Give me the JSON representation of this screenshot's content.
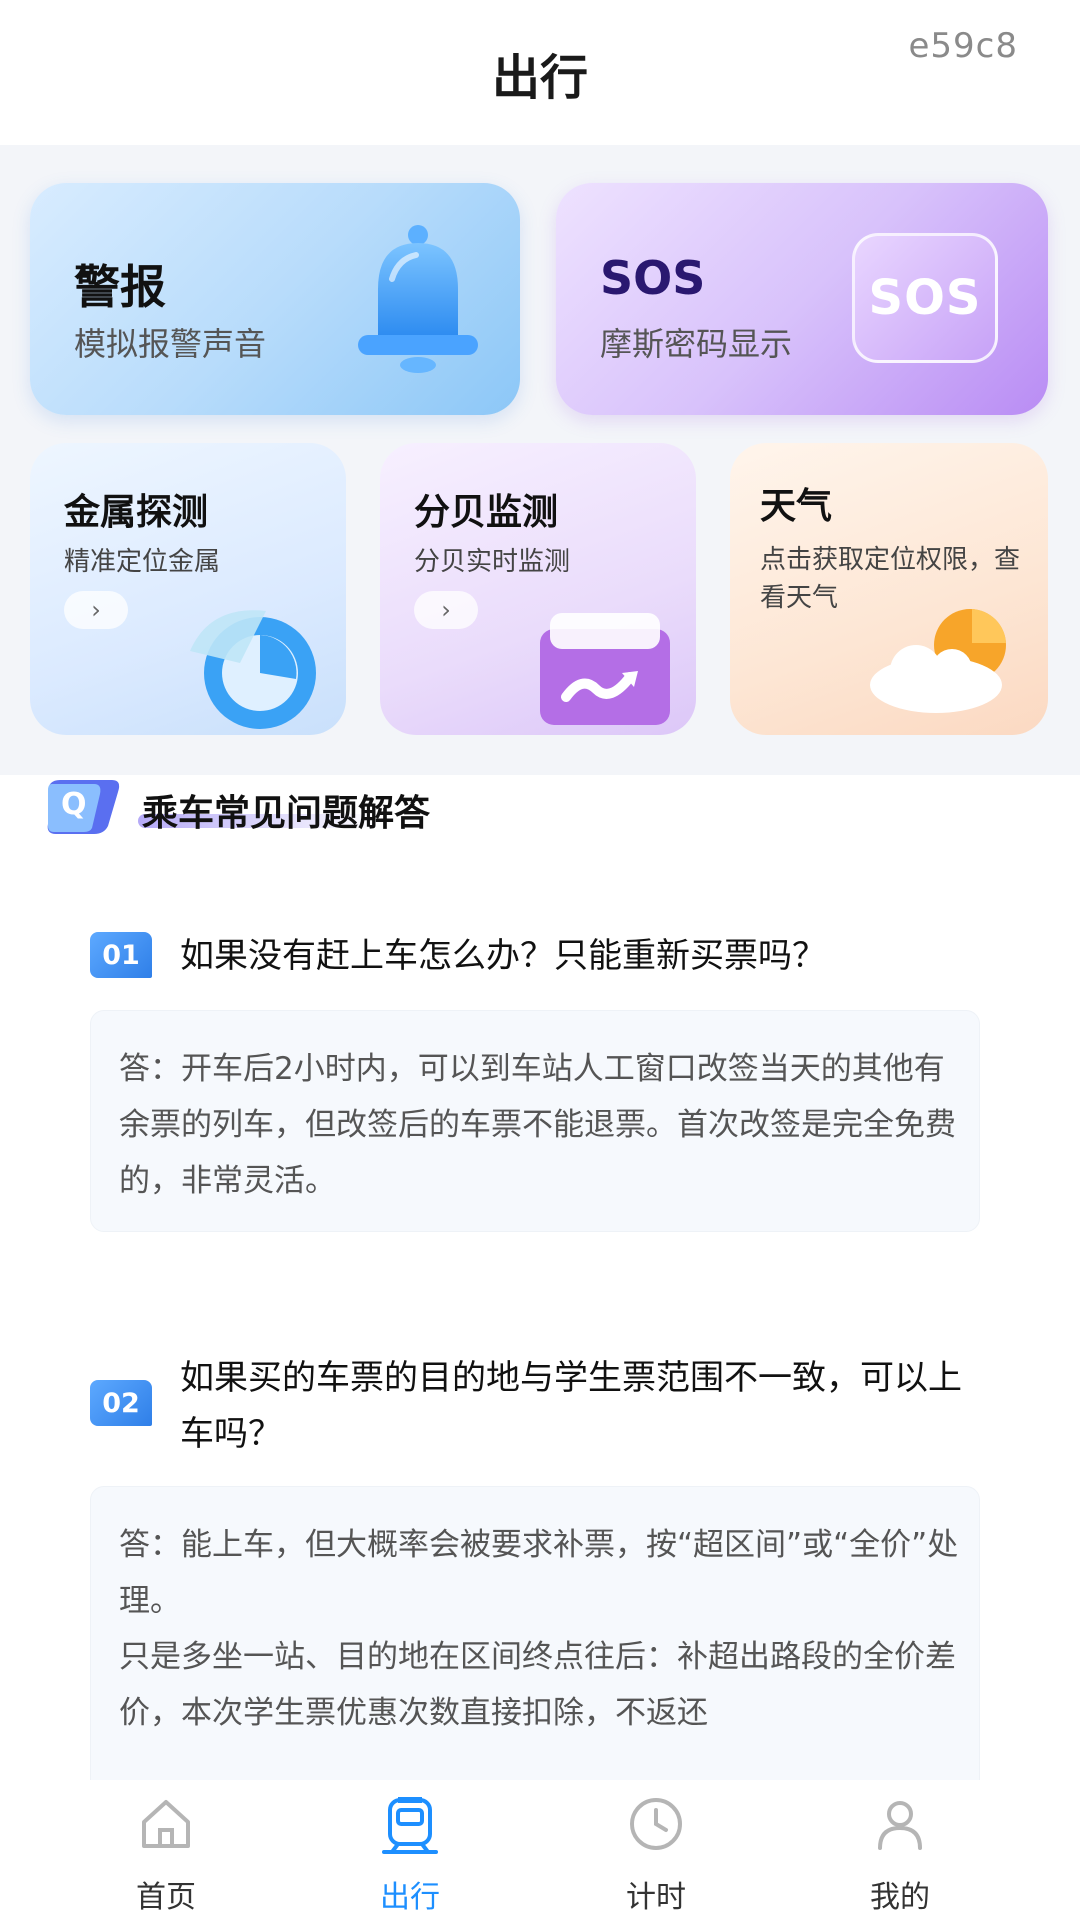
{
  "header": {
    "title": "出行",
    "code": "e59c8"
  },
  "tools": {
    "alarm": {
      "title": "警报",
      "subtitle": "模拟报警声音"
    },
    "sos": {
      "title": "SOS",
      "subtitle": "摩斯密码显示",
      "badge_text": "SOS"
    },
    "metal": {
      "title": "金属探测",
      "subtitle": "精准定位金属",
      "arrow": "›"
    },
    "decibel": {
      "title": "分贝监测",
      "subtitle": "分贝实时监测",
      "arrow": "›"
    },
    "weather": {
      "title": "天气",
      "subtitle": "点击获取定位权限，查看天气"
    }
  },
  "faq": {
    "badge": "Q",
    "title": "乘车常见问题解答",
    "items": [
      {
        "number": "01",
        "question": "如果没有赶上车怎么办？只能重新买票吗？",
        "answer": "答：开车后2小时内，可以到车站人工窗口改签当天的其他有余票的列车，但改签后的车票不能退票。首次改签是完全免费的，非常灵活。"
      },
      {
        "number": "02",
        "question": "如果买的车票的目的地与学生票范围不一致，可以上车吗？",
        "answer": "答：能上车，但大概率会被要求补票，按“超区间”或“全价”处理。\n只是多坐一站、目的地在区间终点往后：补超出路段的全价差价，本次学生票优惠次数直接扣除，不返还"
      }
    ]
  },
  "nav": {
    "items": [
      {
        "label": "首页",
        "icon": "home-icon",
        "active": false
      },
      {
        "label": "出行",
        "icon": "train-icon",
        "active": true
      },
      {
        "label": "计时",
        "icon": "clock-icon",
        "active": false
      },
      {
        "label": "我的",
        "icon": "person-icon",
        "active": false
      }
    ],
    "active_color": "#1d8fff",
    "inactive_color": "#b5b5b5"
  }
}
